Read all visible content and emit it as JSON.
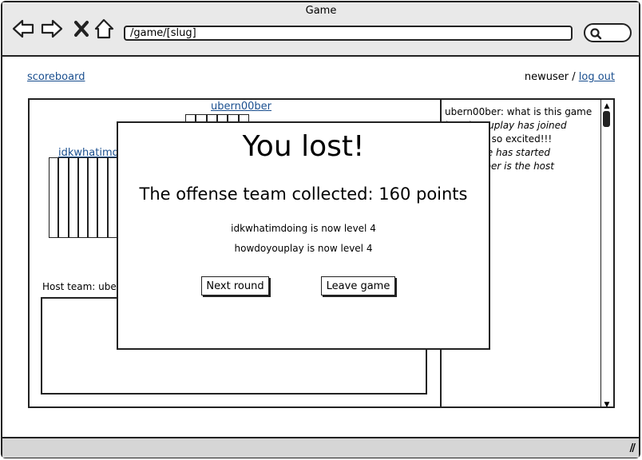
{
  "window": {
    "title": "Game"
  },
  "browser": {
    "url": "/game/[slug]"
  },
  "nav": {
    "scoreboard_link": "scoreboard",
    "username": "newuser",
    "separator": "/",
    "logout_link": "log out"
  },
  "game": {
    "top_player": "ubern00ber",
    "left_player": "idkwhatimdoing",
    "host_team_label": "Host team: ubern00ber"
  },
  "chat": {
    "lines": [
      {
        "text": "ubern00ber: what is this game",
        "italic": false
      },
      {
        "text": "howdoyouplay has joined",
        "italic": true
      },
      {
        "text": "newuser: so excited!!!",
        "italic": false
      },
      {
        "text": "The game has started",
        "italic": true
      },
      {
        "text": "ubern00ber is the host",
        "italic": true
      }
    ]
  },
  "modal": {
    "title": "You lost!",
    "subtitle": "The offense team collected: 160 points",
    "level_lines": [
      "idkwhatimdoing is now level 4",
      "howdoyouplay is now level 4"
    ],
    "next_round_button": "Next round",
    "leave_game_button": "Leave game"
  }
}
